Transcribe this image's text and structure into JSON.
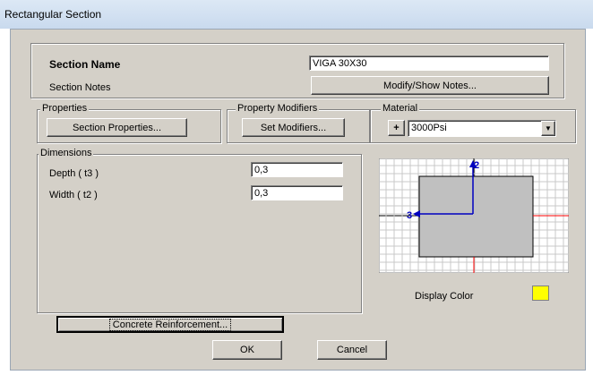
{
  "window": {
    "title": "Rectangular Section"
  },
  "section": {
    "name_label": "Section Name",
    "name_value": "VIGA 30X30",
    "notes_label": "Section Notes",
    "notes_button": "Modify/Show Notes..."
  },
  "properties": {
    "group_label": "Properties",
    "button": "Section Properties..."
  },
  "modifiers": {
    "group_label": "Property Modifiers",
    "button": "Set Modifiers..."
  },
  "material": {
    "group_label": "Material",
    "plus": "+",
    "selected": "3000Psi"
  },
  "dimensions": {
    "group_label": "Dimensions",
    "depth_label": "Depth  ( t3 )",
    "depth_value": "0,3",
    "width_label": "Width  ( t2 )",
    "width_value": "0,3"
  },
  "preview": {
    "axis2": "2",
    "axis3": "3",
    "fill_color": "#c0c0c0"
  },
  "display_color": {
    "label": "Display Color",
    "swatch": "#ffff00"
  },
  "buttons": {
    "reinforcement": "Concrete Reinforcement...",
    "ok": "OK",
    "cancel": "Cancel"
  }
}
